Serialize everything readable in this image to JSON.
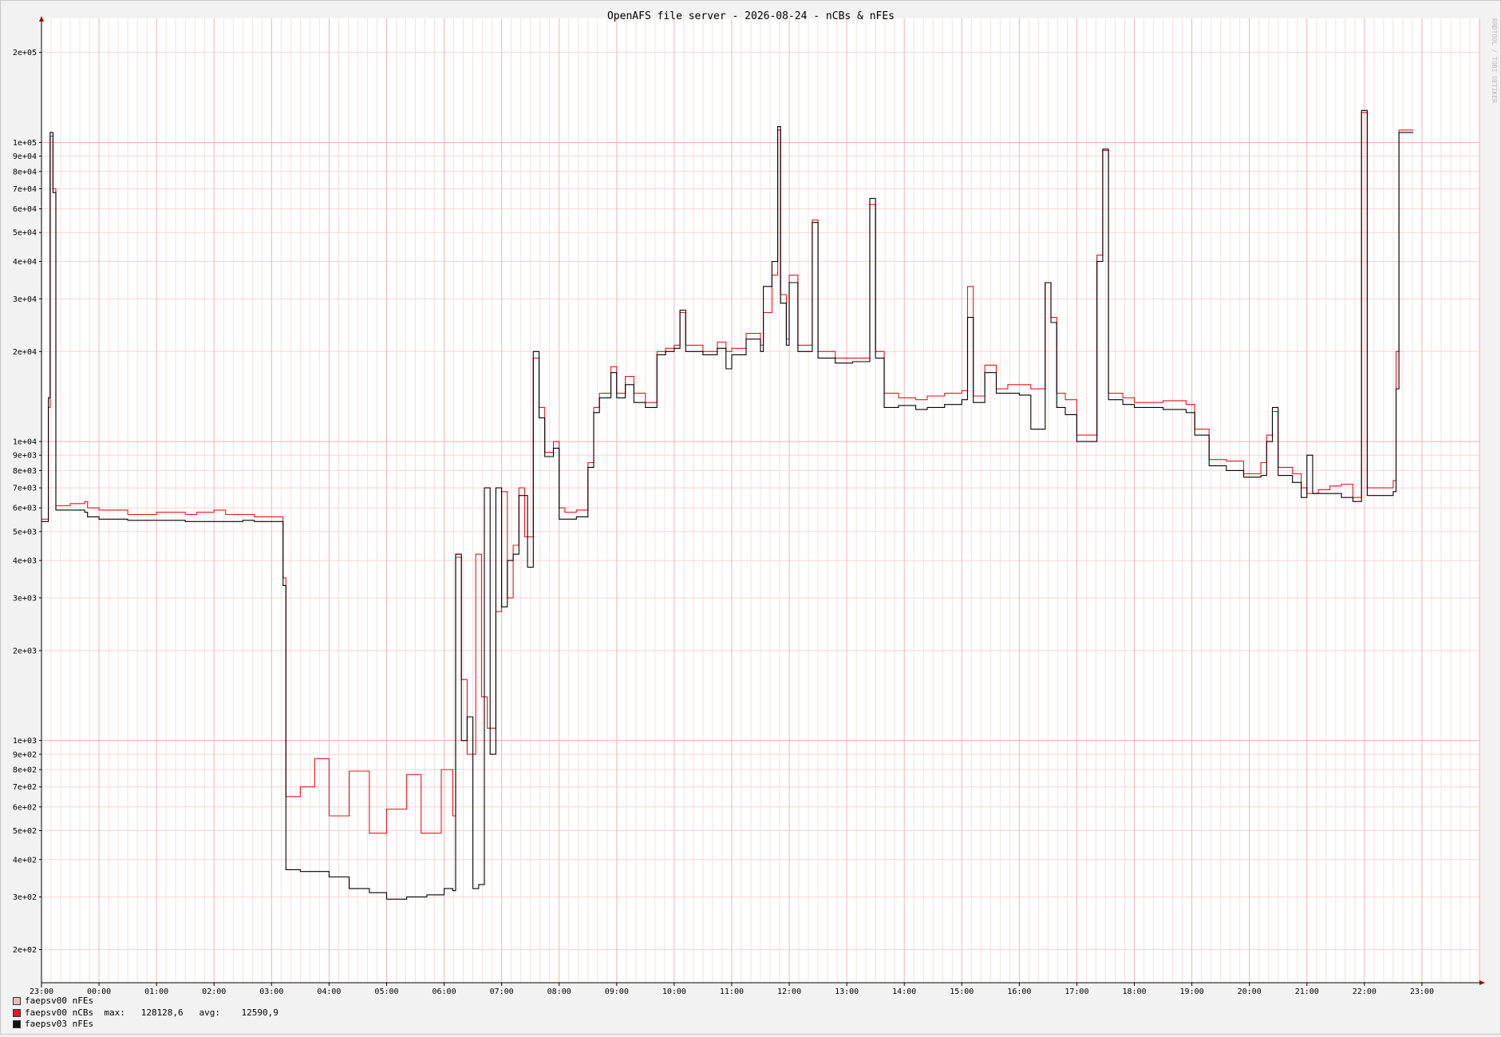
{
  "chart_data": {
    "type": "line",
    "title": "OpenAFS file server - 2026-08-24 - nCBs & nFEs",
    "watermark": "RRDTOOL / TOBI OETIKER",
    "yscale": "log",
    "ylim": [
      155,
      260000
    ],
    "grid": true,
    "legend_position": "bottom-left",
    "x_tick_labels": [
      "23:00",
      "00:00",
      "01:00",
      "02:00",
      "03:00",
      "04:00",
      "05:00",
      "06:00",
      "07:00",
      "08:00",
      "09:00",
      "10:00",
      "11:00",
      "12:00",
      "13:00",
      "14:00",
      "15:00",
      "16:00",
      "17:00",
      "18:00",
      "19:00",
      "20:00",
      "21:00",
      "22:00",
      "23:00"
    ],
    "y_ticks": [
      {
        "value": 200000,
        "label": "2e+05"
      },
      {
        "value": 100000,
        "label": "1e+05"
      },
      {
        "value": 90000,
        "label": "9e+04"
      },
      {
        "value": 80000,
        "label": "8e+04"
      },
      {
        "value": 70000,
        "label": "7e+04"
      },
      {
        "value": 60000,
        "label": "6e+04"
      },
      {
        "value": 50000,
        "label": "5e+04"
      },
      {
        "value": 40000,
        "label": "4e+04"
      },
      {
        "value": 30000,
        "label": "3e+04"
      },
      {
        "value": 20000,
        "label": "2e+04"
      },
      {
        "value": 10000,
        "label": "1e+04"
      },
      {
        "value": 9000,
        "label": "9e+03"
      },
      {
        "value": 8000,
        "label": "8e+03"
      },
      {
        "value": 7000,
        "label": "7e+03"
      },
      {
        "value": 6000,
        "label": "6e+03"
      },
      {
        "value": 5000,
        "label": "5e+03"
      },
      {
        "value": 4000,
        "label": "4e+03"
      },
      {
        "value": 3000,
        "label": "3e+03"
      },
      {
        "value": 2000,
        "label": "2e+03"
      },
      {
        "value": 1000,
        "label": "1e+03"
      },
      {
        "value": 900,
        "label": "9e+02"
      },
      {
        "value": 800,
        "label": "8e+02"
      },
      {
        "value": 700,
        "label": "7e+02"
      },
      {
        "value": 600,
        "label": "6e+02"
      },
      {
        "value": 500,
        "label": "5e+02"
      },
      {
        "value": 400,
        "label": "4e+02"
      },
      {
        "value": 300,
        "label": "3e+02"
      },
      {
        "value": 200,
        "label": "2e+02"
      }
    ],
    "xlim": [
      0,
      25
    ],
    "series": [
      {
        "name": "faepsv00 nCBs",
        "color": "#e8141e",
        "points": [
          [
            0,
            5500
          ],
          [
            0.05,
            5500
          ],
          [
            0.12,
            13000
          ],
          [
            0.15,
            105000
          ],
          [
            0.2,
            70000
          ],
          [
            0.25,
            6100
          ],
          [
            0.5,
            6200
          ],
          [
            0.75,
            6300
          ],
          [
            0.8,
            6000
          ],
          [
            1.0,
            5900
          ],
          [
            1.5,
            5700
          ],
          [
            2.0,
            5800
          ],
          [
            2.5,
            5700
          ],
          [
            2.7,
            5800
          ],
          [
            3.0,
            5900
          ],
          [
            3.2,
            5700
          ],
          [
            3.7,
            5600
          ],
          [
            4.2,
            5600
          ],
          [
            4.2,
            3500
          ],
          [
            4.25,
            650
          ],
          [
            4.5,
            700
          ],
          [
            4.75,
            870
          ],
          [
            5.0,
            560
          ],
          [
            5.35,
            790
          ],
          [
            5.7,
            490
          ],
          [
            6.0,
            590
          ],
          [
            6.35,
            770
          ],
          [
            6.6,
            490
          ],
          [
            6.95,
            800
          ],
          [
            7.15,
            560
          ],
          [
            7.2,
            4100
          ],
          [
            7.3,
            1600
          ],
          [
            7.4,
            900
          ],
          [
            7.55,
            4200
          ],
          [
            7.65,
            1400
          ],
          [
            7.75,
            1100
          ],
          [
            7.9,
            2700
          ],
          [
            8.0,
            6800
          ],
          [
            8.1,
            3000
          ],
          [
            8.2,
            4500
          ],
          [
            8.3,
            7000
          ],
          [
            8.4,
            4800
          ],
          [
            8.55,
            19000
          ],
          [
            8.65,
            13000
          ],
          [
            8.75,
            9200
          ],
          [
            8.9,
            10000
          ],
          [
            9.0,
            6000
          ],
          [
            9.1,
            5800
          ],
          [
            9.3,
            5900
          ],
          [
            9.5,
            8500
          ],
          [
            9.6,
            13000
          ],
          [
            9.7,
            14500
          ],
          [
            9.9,
            17800
          ],
          [
            10.0,
            14500
          ],
          [
            10.15,
            16500
          ],
          [
            10.3,
            14500
          ],
          [
            10.5,
            13500
          ],
          [
            10.7,
            20000
          ],
          [
            10.85,
            20500
          ],
          [
            11.0,
            21000
          ],
          [
            11.1,
            27000
          ],
          [
            11.2,
            21000
          ],
          [
            11.5,
            20000
          ],
          [
            11.75,
            21500
          ],
          [
            11.9,
            20000
          ],
          [
            12.0,
            20500
          ],
          [
            12.25,
            23000
          ],
          [
            12.5,
            21000
          ],
          [
            12.55,
            27000
          ],
          [
            12.7,
            36000
          ],
          [
            12.8,
            110000
          ],
          [
            12.85,
            31000
          ],
          [
            12.95,
            22000
          ],
          [
            13.0,
            36000
          ],
          [
            13.15,
            21000
          ],
          [
            13.4,
            55000
          ],
          [
            13.5,
            20000
          ],
          [
            13.8,
            19000
          ],
          [
            14.1,
            19000
          ],
          [
            14.4,
            62000
          ],
          [
            14.5,
            20000
          ],
          [
            14.65,
            14500
          ],
          [
            14.9,
            14000
          ],
          [
            15.2,
            13800
          ],
          [
            15.4,
            14200
          ],
          [
            15.7,
            14500
          ],
          [
            16.0,
            14800
          ],
          [
            16.1,
            33000
          ],
          [
            16.2,
            14200
          ],
          [
            16.4,
            18000
          ],
          [
            16.6,
            15000
          ],
          [
            16.8,
            15500
          ],
          [
            17.0,
            15500
          ],
          [
            17.2,
            15000
          ],
          [
            17.45,
            34000
          ],
          [
            17.55,
            26000
          ],
          [
            17.65,
            14500
          ],
          [
            17.8,
            13800
          ],
          [
            18.0,
            10500
          ],
          [
            18.2,
            10500
          ],
          [
            18.35,
            42000
          ],
          [
            18.45,
            94000
          ],
          [
            18.55,
            14500
          ],
          [
            18.8,
            14000
          ],
          [
            19.0,
            13500
          ],
          [
            19.5,
            13700
          ],
          [
            19.9,
            13300
          ],
          [
            20.05,
            11000
          ],
          [
            20.3,
            8700
          ],
          [
            20.6,
            8600
          ],
          [
            20.9,
            7800
          ],
          [
            21.2,
            8500
          ],
          [
            21.3,
            10500
          ],
          [
            21.4,
            12600
          ],
          [
            21.5,
            8200
          ],
          [
            21.75,
            7800
          ],
          [
            21.9,
            7000
          ],
          [
            22.0,
            6700
          ],
          [
            22.2,
            6900
          ],
          [
            22.4,
            7100
          ],
          [
            22.6,
            7200
          ],
          [
            22.8,
            6500
          ],
          [
            22.85,
            6500
          ],
          [
            22.95,
            126000
          ],
          [
            23.05,
            7000
          ],
          [
            23.5,
            7400
          ],
          [
            23.55,
            20000
          ],
          [
            23.6,
            110000
          ],
          [
            23.85,
            110000
          ]
        ]
      },
      {
        "name": "faepsv03 nFEs",
        "color": "#000000",
        "points": [
          [
            0,
            5400
          ],
          [
            0.05,
            5400
          ],
          [
            0.12,
            14000
          ],
          [
            0.15,
            108000
          ],
          [
            0.2,
            68000
          ],
          [
            0.25,
            5900
          ],
          [
            0.5,
            5900
          ],
          [
            0.75,
            5800
          ],
          [
            0.8,
            5600
          ],
          [
            1.0,
            5500
          ],
          [
            1.5,
            5450
          ],
          [
            2.0,
            5450
          ],
          [
            2.5,
            5400
          ],
          [
            3.0,
            5400
          ],
          [
            3.5,
            5450
          ],
          [
            3.7,
            5400
          ],
          [
            4.2,
            5400
          ],
          [
            4.2,
            3300
          ],
          [
            4.25,
            370
          ],
          [
            4.5,
            365
          ],
          [
            5.0,
            350
          ],
          [
            5.35,
            320
          ],
          [
            5.7,
            310
          ],
          [
            6.0,
            295
          ],
          [
            6.35,
            300
          ],
          [
            6.7,
            305
          ],
          [
            7.0,
            320
          ],
          [
            7.15,
            315
          ],
          [
            7.2,
            4200
          ],
          [
            7.3,
            1000
          ],
          [
            7.4,
            1200
          ],
          [
            7.5,
            320
          ],
          [
            7.6,
            330
          ],
          [
            7.7,
            7000
          ],
          [
            7.8,
            900
          ],
          [
            7.9,
            7000
          ],
          [
            8.0,
            2800
          ],
          [
            8.1,
            4000
          ],
          [
            8.2,
            4200
          ],
          [
            8.3,
            6600
          ],
          [
            8.45,
            3800
          ],
          [
            8.55,
            20000
          ],
          [
            8.65,
            12000
          ],
          [
            8.75,
            8900
          ],
          [
            8.9,
            9500
          ],
          [
            9.0,
            5500
          ],
          [
            9.1,
            5500
          ],
          [
            9.3,
            5600
          ],
          [
            9.5,
            8200
          ],
          [
            9.6,
            12500
          ],
          [
            9.7,
            14000
          ],
          [
            9.9,
            17000
          ],
          [
            10.0,
            14000
          ],
          [
            10.15,
            15500
          ],
          [
            10.3,
            13500
          ],
          [
            10.5,
            13000
          ],
          [
            10.7,
            19500
          ],
          [
            10.85,
            20000
          ],
          [
            11.0,
            20500
          ],
          [
            11.1,
            27500
          ],
          [
            11.2,
            20000
          ],
          [
            11.5,
            19500
          ],
          [
            11.75,
            20500
          ],
          [
            11.9,
            17500
          ],
          [
            12.0,
            19500
          ],
          [
            12.25,
            22000
          ],
          [
            12.5,
            20000
          ],
          [
            12.55,
            33000
          ],
          [
            12.7,
            40000
          ],
          [
            12.8,
            113000
          ],
          [
            12.85,
            29000
          ],
          [
            12.95,
            21000
          ],
          [
            13.0,
            34000
          ],
          [
            13.15,
            20000
          ],
          [
            13.4,
            54000
          ],
          [
            13.5,
            19000
          ],
          [
            13.8,
            18300
          ],
          [
            14.1,
            18500
          ],
          [
            14.4,
            65000
          ],
          [
            14.5,
            19000
          ],
          [
            14.65,
            13000
          ],
          [
            14.9,
            13200
          ],
          [
            15.2,
            12800
          ],
          [
            15.4,
            13000
          ],
          [
            15.7,
            13300
          ],
          [
            16.0,
            13800
          ],
          [
            16.1,
            26000
          ],
          [
            16.2,
            13500
          ],
          [
            16.4,
            17000
          ],
          [
            16.6,
            14500
          ],
          [
            16.8,
            14500
          ],
          [
            17.0,
            14300
          ],
          [
            17.2,
            11000
          ],
          [
            17.45,
            34000
          ],
          [
            17.55,
            25000
          ],
          [
            17.65,
            13000
          ],
          [
            17.8,
            12300
          ],
          [
            18.0,
            10000
          ],
          [
            18.2,
            10000
          ],
          [
            18.35,
            40000
          ],
          [
            18.45,
            95000
          ],
          [
            18.55,
            13800
          ],
          [
            18.8,
            13300
          ],
          [
            19.0,
            13000
          ],
          [
            19.5,
            12800
          ],
          [
            19.9,
            12500
          ],
          [
            20.05,
            10500
          ],
          [
            20.3,
            8300
          ],
          [
            20.6,
            8000
          ],
          [
            20.9,
            7600
          ],
          [
            21.2,
            7700
          ],
          [
            21.3,
            10000
          ],
          [
            21.4,
            13000
          ],
          [
            21.5,
            7700
          ],
          [
            21.75,
            7300
          ],
          [
            21.9,
            6500
          ],
          [
            22.0,
            9000
          ],
          [
            22.1,
            6700
          ],
          [
            22.4,
            6700
          ],
          [
            22.6,
            6500
          ],
          [
            22.8,
            6300
          ],
          [
            22.85,
            6300
          ],
          [
            22.95,
            128000
          ],
          [
            23.05,
            6600
          ],
          [
            23.5,
            6800
          ],
          [
            23.55,
            15000
          ],
          [
            23.6,
            108000
          ],
          [
            23.85,
            108000
          ]
        ]
      }
    ],
    "legend": [
      {
        "label": "faepsv00 nFEs",
        "color": "#f0b8b8",
        "stats": ""
      },
      {
        "label": "faepsv00 nCBs",
        "color": "#e8141e",
        "stats": "  max:   128128,6   avg:    12590,9"
      },
      {
        "label": "faepsv03 nFEs",
        "color": "#111111",
        "stats": ""
      }
    ]
  }
}
